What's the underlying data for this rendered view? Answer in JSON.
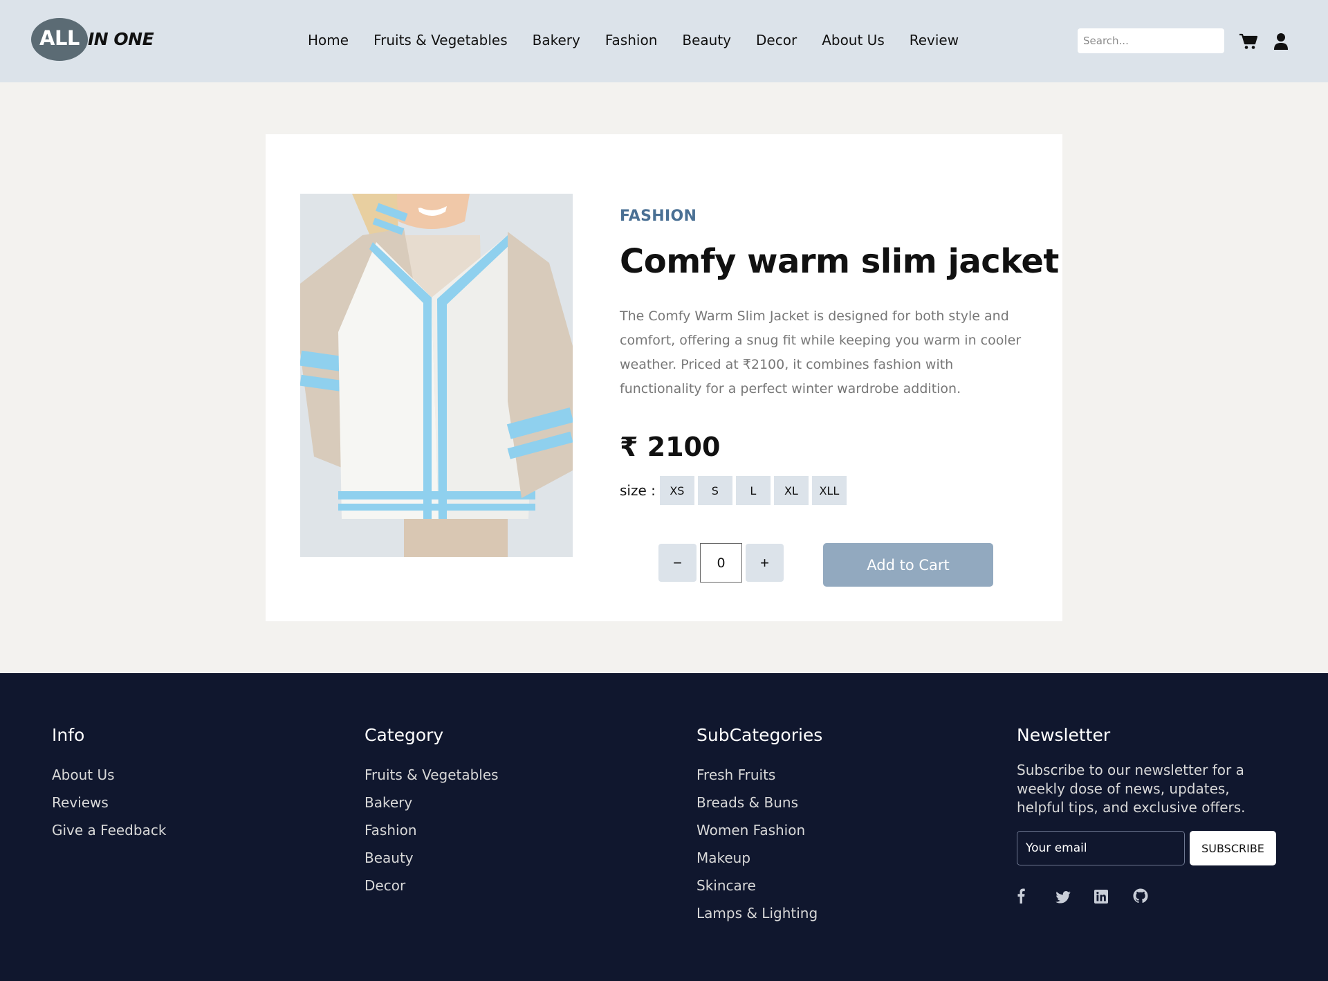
{
  "header": {
    "logo": {
      "all": "ALL",
      "one": "IN ONE"
    },
    "nav": [
      "Home",
      "Fruits & Vegetables",
      "Bakery",
      "Fashion",
      "Beauty",
      "Decor",
      "About Us",
      "Review"
    ],
    "search_placeholder": "Search...",
    "icons": {
      "cart": "cart-icon",
      "user": "user-icon"
    }
  },
  "product": {
    "category": "FASHION",
    "title": "Comfy warm slim jacket",
    "description": "The Comfy Warm Slim Jacket is designed for both style and comfort, offering a snug fit while keeping you warm in cooler weather. Priced at ₹2100, it combines fashion with functionality for a perfect winter wardrobe addition.",
    "price": "₹ 2100",
    "size_label": "size :",
    "sizes": [
      "XS",
      "S",
      "L",
      "XL",
      "XLL"
    ],
    "quantity": "0",
    "decrement": "−",
    "increment": "+",
    "add_to_cart": "Add to Cart"
  },
  "footer": {
    "info": {
      "heading": "Info",
      "links": [
        "About Us",
        "Reviews",
        "Give a Feedback"
      ]
    },
    "category": {
      "heading": "Category",
      "links": [
        "Fruits & Vegetables",
        "Bakery",
        "Fashion",
        "Beauty",
        "Decor"
      ]
    },
    "subcategories": {
      "heading": "SubCategories",
      "links": [
        "Fresh Fruits",
        "Breads & Buns",
        "Women Fashion",
        "Makeup",
        "Skincare",
        "Lamps & Lighting"
      ]
    },
    "newsletter": {
      "heading": "Newsletter",
      "text": "Subscribe to our newsletter for a weekly dose of news, updates, helpful tips, and exclusive offers.",
      "email_placeholder": "Your email",
      "subscribe": "SUBSCRIBE",
      "socials": [
        "facebook-icon",
        "twitter-icon",
        "linkedin-icon",
        "github-icon"
      ]
    }
  },
  "colors": {
    "header_bg": "#dce3ea",
    "page_bg": "#f3f2ef",
    "footer_bg": "#10172e",
    "category_accent": "#4a7094",
    "add_to_cart_bg": "#92a9bf"
  }
}
